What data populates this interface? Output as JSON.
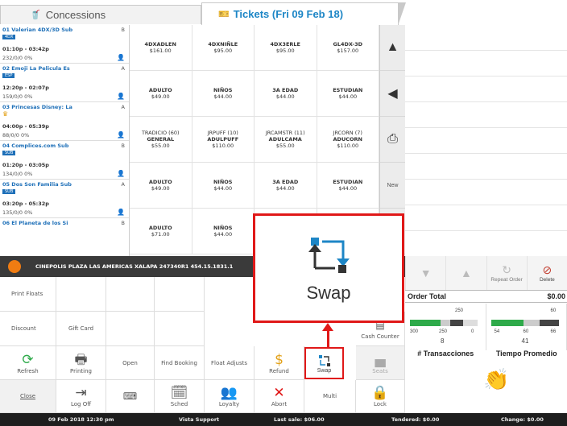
{
  "tabs": {
    "concessions": "Concessions",
    "tickets": "Tickets (Fri 09 Feb 18)"
  },
  "movies": [
    {
      "title": "01 Valerian 4DX/3D Sub",
      "aud": "B",
      "badge": "4DX",
      "time": "01:10p - 03:42p",
      "stats": "232/0/0 0%"
    },
    {
      "title": "02 Emoji La Pelicula Es",
      "aud": "A",
      "badge": "ESP",
      "time": "12:20p - 02:07p",
      "stats": "159/0/0 0%"
    },
    {
      "title": "03 Princesas Disney: La",
      "aud": "A",
      "badge": "",
      "time": "04:00p - 05:39p",
      "stats": "88/0/0 0%"
    },
    {
      "title": "04 Complices.com Sub",
      "aud": "B",
      "badge": "SUB",
      "time": "01:20p - 03:05p",
      "stats": "134/0/0 0%"
    },
    {
      "title": "05 Dos Son Familia Sub",
      "aud": "A",
      "badge": "SUB",
      "time": "03:20p - 05:32p",
      "stats": "135/0/0 0%"
    },
    {
      "title": "06 El Planeta de los Si",
      "aud": "B",
      "badge": "",
      "time": "",
      "stats": ""
    }
  ],
  "prices": [
    {
      "l1": "",
      "l2": "4DXADLEN",
      "l3": "$161.00"
    },
    {
      "l1": "",
      "l2": "4DXNIÑLE",
      "l3": "$95.00"
    },
    {
      "l1": "",
      "l2": "4DX3ERLE",
      "l3": "$95.00"
    },
    {
      "l1": "",
      "l2": "GL4DX-3D",
      "l3": "$157.00"
    },
    {
      "l1": "",
      "l2": "ADULTO",
      "l3": "$49.00"
    },
    {
      "l1": "",
      "l2": "NIÑOS",
      "l3": "$44.00"
    },
    {
      "l1": "",
      "l2": "3A EDAD",
      "l3": "$44.00"
    },
    {
      "l1": "",
      "l2": "ESTUDIAN",
      "l3": "$44.00"
    },
    {
      "l1": "TRADICIO (60)",
      "l2": "GENERAL",
      "l3": "$55.00"
    },
    {
      "l1": "JRPUFF (10)",
      "l2": "ADULPUFF",
      "l3": "$110.00"
    },
    {
      "l1": "JRCAMSTR (11)",
      "l2": "ADULCAMA",
      "l3": "$55.00"
    },
    {
      "l1": "JRCORN (7)",
      "l2": "ADUCORN",
      "l3": "$110.00"
    },
    {
      "l1": "",
      "l2": "ADULTO",
      "l3": "$49.00"
    },
    {
      "l1": "",
      "l2": "NIÑOS",
      "l3": "$44.00"
    },
    {
      "l1": "",
      "l2": "3A EDAD",
      "l3": "$44.00"
    },
    {
      "l1": "",
      "l2": "ESTUDIAN",
      "l3": "$44.00"
    },
    {
      "l1": "",
      "l2": "ADULTO",
      "l3": "$71.00"
    },
    {
      "l1": "",
      "l2": "NIÑOS",
      "l3": "$44.00"
    },
    {
      "l1": "",
      "l2": "",
      "l3": ""
    },
    {
      "l1": "",
      "l2": "",
      "l3": ""
    }
  ],
  "nav": {
    "up": "▲",
    "back": "◀",
    "receipt": "⎙",
    "new": "New"
  },
  "cinema_bar": "CINEPOLIS PLAZA LAS AMERICAS XALAPA  247340R1  454.15.1831.1",
  "controls": {
    "repeat": "Repeat Order",
    "delete": "Delete"
  },
  "order": {
    "label": "Order Total",
    "value": "$0.00"
  },
  "stats": [
    {
      "marker": "250",
      "ticks": [
        "300",
        "250",
        "0"
      ],
      "value": "8"
    },
    {
      "marker": "60",
      "ticks": [
        "54",
        "60",
        "66"
      ],
      "value": "41"
    }
  ],
  "stat_labels": [
    "# Transacciones",
    "Tiempo Promedio"
  ],
  "buttons": {
    "print_floats": "Print Floats",
    "discount": "Discount",
    "gift_card": "Gift Card",
    "cash_counter": "Cash Counter",
    "refresh": "Refresh",
    "printing": "Printing",
    "open": "Open",
    "find_booking": "Find Booking",
    "float_adjusts": "Float Adjusts",
    "refund": "Refund",
    "swap": "Swap",
    "seats": "Seats",
    "close": "Close",
    "log_off": "Log Off",
    "sched": "Sched",
    "loyalty": "Loyalty",
    "abort": "Abort",
    "multi": "Multi",
    "lock": "Lock"
  },
  "callout": {
    "label": "Swap"
  },
  "status": {
    "date": "09 Feb 2018 12:30 pm",
    "support": "Vista Support",
    "last_sale": "Last sale: $06.00",
    "tendered": "Tendered: $0.00",
    "change": "Change: $0.00"
  },
  "colors": {
    "accent": "#1d86c6",
    "highlight": "#e01818",
    "orange": "#f07c12",
    "green": "#2eaa4a"
  }
}
